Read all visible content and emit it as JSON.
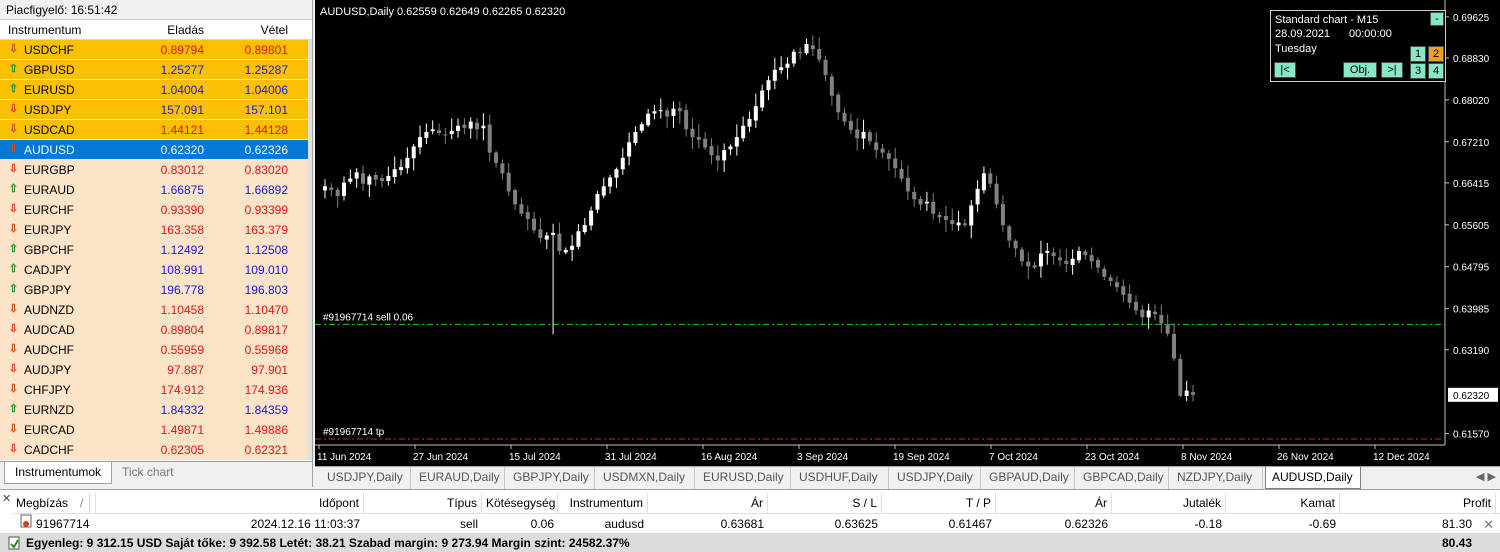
{
  "market_watch": {
    "title": "Piacfigyelő: 16:51:42",
    "headers": {
      "symbol": "Instrumentum",
      "bid": "Eladás",
      "ask": "Vétel"
    },
    "rows": [
      {
        "symbol": "USDCHF",
        "bid": "0.89794",
        "ask": "0.89801",
        "dir": "down",
        "bg": "#fcc003",
        "color": "#e01414"
      },
      {
        "symbol": "GBPUSD",
        "bid": "1.25277",
        "ask": "1.25287",
        "dir": "up",
        "bg": "#fcc003",
        "color": "#1a1ad6"
      },
      {
        "symbol": "EURUSD",
        "bid": "1.04004",
        "ask": "1.04006",
        "dir": "up",
        "bg": "#fcc003",
        "color": "#1a1ad6"
      },
      {
        "symbol": "USDJPY",
        "bid": "157.091",
        "ask": "157.101",
        "dir": "down",
        "bg": "#fcc003",
        "color": "#1a1ad6"
      },
      {
        "symbol": "USDCAD",
        "bid": "1.44121",
        "ask": "1.44128",
        "dir": "down",
        "bg": "#fcc003",
        "color": "#e01414"
      },
      {
        "symbol": "AUDUSD",
        "bid": "0.62320",
        "ask": "0.62326",
        "dir": "down",
        "bg": "#0078d7",
        "color": "#ffffff",
        "selected": true
      },
      {
        "symbol": "EURGBP",
        "bid": "0.83012",
        "ask": "0.83020",
        "dir": "down",
        "bg": "#fde3c8",
        "color": "#e01414"
      },
      {
        "symbol": "EURAUD",
        "bid": "1.66875",
        "ask": "1.66892",
        "dir": "up",
        "bg": "#fde3c8",
        "color": "#1a1ad6"
      },
      {
        "symbol": "EURCHF",
        "bid": "0.93390",
        "ask": "0.93399",
        "dir": "down",
        "bg": "#fde3c8",
        "color": "#e01414"
      },
      {
        "symbol": "EURJPY",
        "bid": "163.358",
        "ask": "163.379",
        "dir": "down",
        "bg": "#fde3c8",
        "color": "#e01414"
      },
      {
        "symbol": "GBPCHF",
        "bid": "1.12492",
        "ask": "1.12508",
        "dir": "up",
        "bg": "#fde3c8",
        "color": "#1a1ad6"
      },
      {
        "symbol": "CADJPY",
        "bid": "108.991",
        "ask": "109.010",
        "dir": "up",
        "bg": "#fde3c8",
        "color": "#1a1ad6"
      },
      {
        "symbol": "GBPJPY",
        "bid": "196.778",
        "ask": "196.803",
        "dir": "up",
        "bg": "#fde3c8",
        "color": "#1a1ad6"
      },
      {
        "symbol": "AUDNZD",
        "bid": "1.10458",
        "ask": "1.10470",
        "dir": "down",
        "bg": "#fde3c8",
        "color": "#e01414"
      },
      {
        "symbol": "AUDCAD",
        "bid": "0.89804",
        "ask": "0.89817",
        "dir": "down",
        "bg": "#fde3c8",
        "color": "#e01414"
      },
      {
        "symbol": "AUDCHF",
        "bid": "0.55959",
        "ask": "0.55968",
        "dir": "down",
        "bg": "#fde3c8",
        "color": "#e01414"
      },
      {
        "symbol": "AUDJPY",
        "bid": "97.887",
        "ask": "97.901",
        "dir": "down",
        "bg": "#fde3c8",
        "color": "#e01414"
      },
      {
        "symbol": "CHFJPY",
        "bid": "174.912",
        "ask": "174.936",
        "dir": "down",
        "bg": "#fde3c8",
        "color": "#e01414"
      },
      {
        "symbol": "EURNZD",
        "bid": "1.84332",
        "ask": "1.84359",
        "dir": "up",
        "bg": "#fde3c8",
        "color": "#1a1ad6"
      },
      {
        "symbol": "EURCAD",
        "bid": "1.49871",
        "ask": "1.49886",
        "dir": "down",
        "bg": "#fde3c8",
        "color": "#e01414"
      },
      {
        "symbol": "CADCHF",
        "bid": "0.62305",
        "ask": "0.62321",
        "dir": "down",
        "bg": "#fde3c8",
        "color": "#e01414"
      }
    ],
    "tabs": [
      {
        "label": "Instrumentumok",
        "active": true
      },
      {
        "label": "Tick chart",
        "active": false
      }
    ]
  },
  "chart": {
    "title": "AUDUSD,Daily  0.62559 0.62649 0.62265 0.62320",
    "current_price": "0.62320",
    "price_labels": [
      "0.69625",
      "0.68830",
      "0.68020",
      "0.67210",
      "0.66415",
      "0.65605",
      "0.64795",
      "0.63985",
      "0.63190",
      "0.61570"
    ],
    "date_labels": [
      "11 Jun 2024",
      "27 Jun 2024",
      "15 Jul 2024",
      "31 Jul 2024",
      "16 Aug 2024",
      "3 Sep 2024",
      "19 Sep 2024",
      "7 Oct 2024",
      "23 Oct 2024",
      "8 Nov 2024",
      "26 Nov 2024",
      "12 Dec 2024"
    ],
    "order_lines": [
      {
        "label": "#91967714 sell 0.06",
        "price": 0.63681,
        "color": "#28c828"
      },
      {
        "label": "#91967714 tp",
        "price": 0.61467,
        "color": "#e02020"
      }
    ],
    "colors": {
      "bull": "#ffffff",
      "bear": "#808080",
      "background": "#000000"
    }
  },
  "chart_data": {
    "type": "candlestick",
    "title": "AUDUSD,Daily",
    "x_start": "11 Jun 2024",
    "x_end": "19 Dec 2024",
    "ylim": [
      0.6135,
      0.6995
    ],
    "closes": [
      0.6635,
      0.6628,
      0.6616,
      0.6642,
      0.665,
      0.6662,
      0.664,
      0.6654,
      0.6648,
      0.6645,
      0.6655,
      0.6668,
      0.6672,
      0.669,
      0.6712,
      0.673,
      0.674,
      0.6745,
      0.6738,
      0.6735,
      0.6742,
      0.6752,
      0.6748,
      0.676,
      0.6745,
      0.6752,
      0.67,
      0.668,
      0.666,
      0.6625,
      0.66,
      0.6582,
      0.6572,
      0.655,
      0.6535,
      0.654,
      0.6545,
      0.651,
      0.6512,
      0.652,
      0.6548,
      0.656,
      0.6588,
      0.662,
      0.6635,
      0.6652,
      0.6668,
      0.669,
      0.672,
      0.674,
      0.6755,
      0.6775,
      0.678,
      0.6782,
      0.677,
      0.6785,
      0.678,
      0.6745,
      0.673,
      0.6725,
      0.671,
      0.6695,
      0.6685,
      0.6705,
      0.6712,
      0.673,
      0.6752,
      0.6765,
      0.679,
      0.682,
      0.684,
      0.686,
      0.6865,
      0.6872,
      0.6895,
      0.6892,
      0.691,
      0.69,
      0.688,
      0.685,
      0.681,
      0.6778,
      0.676,
      0.6744,
      0.6728,
      0.674,
      0.6722,
      0.6705,
      0.67,
      0.6688,
      0.667,
      0.665,
      0.6625,
      0.661,
      0.66,
      0.6605,
      0.6582,
      0.6575,
      0.657,
      0.6562,
      0.6565,
      0.656,
      0.6598,
      0.663,
      0.666,
      0.664,
      0.66,
      0.656,
      0.653,
      0.6515,
      0.649,
      0.648,
      0.6478,
      0.6505,
      0.651,
      0.65,
      0.6492,
      0.6485,
      0.6495,
      0.651,
      0.6502,
      0.649,
      0.6478,
      0.646,
      0.6452,
      0.644,
      0.6425,
      0.641,
      0.6395,
      0.6382,
      0.6395,
      0.6388,
      0.637,
      0.635,
      0.6302,
      0.623,
      0.624,
      0.6232
    ],
    "current": 0.6232
  },
  "navigator": {
    "title": "Standard chart - M15",
    "date": "28.09.2021",
    "time": "00:00:00",
    "day": "Tuesday",
    "btn_min": "-",
    "btn_first": "|<",
    "btn_obj": "Obj.",
    "btn_next": ">|",
    "grid": [
      "1",
      "2",
      "3",
      "4"
    ]
  },
  "chart_tabs": [
    {
      "label": "USDJPY,Daily",
      "active": false
    },
    {
      "label": "EURAUD,Daily",
      "active": false
    },
    {
      "label": "GBPJPY,Daily",
      "active": false
    },
    {
      "label": "USDMXN,Daily",
      "active": false
    },
    {
      "label": "EURUSD,Daily",
      "active": false
    },
    {
      "label": "USDHUF,Daily",
      "active": false
    },
    {
      "label": "USDJPY,Daily",
      "active": false
    },
    {
      "label": "GBPAUD,Daily",
      "active": false
    },
    {
      "label": "GBPCAD,Daily",
      "active": false
    },
    {
      "label": "NZDJPY,Daily",
      "active": false
    },
    {
      "label": "AUDUSD,Daily",
      "active": true
    }
  ],
  "chart_tabs_arrows": "◀ ▶",
  "terminal": {
    "headers": {
      "order": "Megbízás",
      "sort": "/",
      "time": "Időpont",
      "type": "Típus",
      "volume": "Kötésegység",
      "symbol": "Instrumentum",
      "price": "Ár",
      "sl": "S / L",
      "tp": "T / P",
      "cur_price": "Ár",
      "commission": "Jutalék",
      "swap": "Kamat",
      "profit": "Profit"
    },
    "position": {
      "order": "91967714",
      "time": "2024.12.16 11:03:37",
      "type": "sell",
      "volume": "0.06",
      "symbol": "audusd",
      "price": "0.63681",
      "sl": "0.63625",
      "tp": "0.61467",
      "cur_price": "0.62326",
      "commission": "-0.18",
      "swap": "-0.69",
      "profit": "81.30"
    },
    "balance_line": "Egyenleg: 9 312.15 USD  Saját tőke: 9 392.58  Letét: 38.21  Szabad margin: 9 273.94  Margin szint: 24582.37%",
    "total_profit": "80.43"
  }
}
